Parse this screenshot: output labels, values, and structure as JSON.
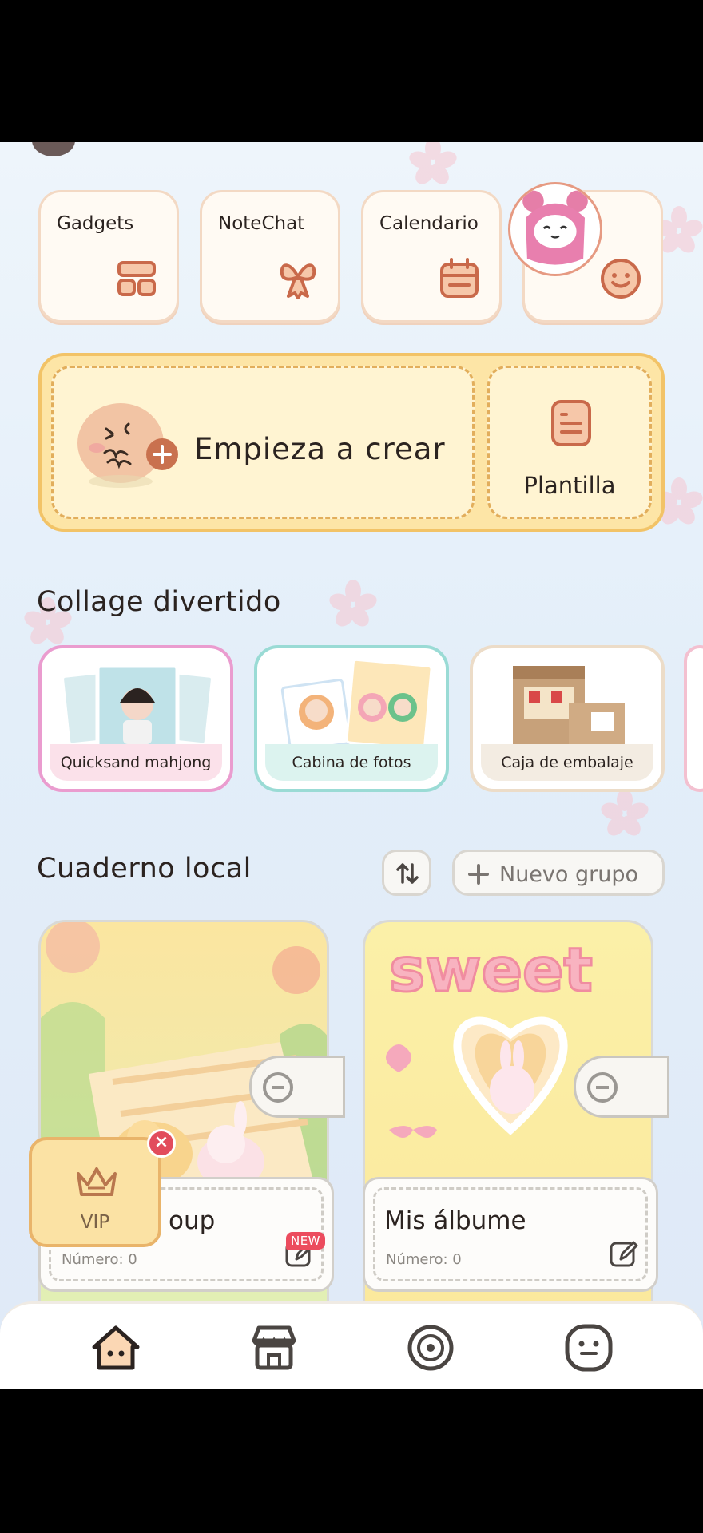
{
  "tiles": [
    {
      "label": "Gadgets",
      "icon": "widgets-icon"
    },
    {
      "label": "NoteChat",
      "icon": "bow-icon"
    },
    {
      "label": "Calendario",
      "icon": "calendar-icon"
    },
    {
      "label": "",
      "icon": "smiley-icon"
    }
  ],
  "create": {
    "title": "Empieza a crear",
    "template_label": "Plantilla"
  },
  "collage": {
    "title": "Collage divertido",
    "items": [
      {
        "label": "Quicksand mahjong"
      },
      {
        "label": "Cabina de fotos"
      },
      {
        "label": "Caja de embalaje"
      }
    ]
  },
  "local": {
    "title": "Cuaderno local",
    "new_group": "Nuevo grupo",
    "notebooks": [
      {
        "name": "oup",
        "count": "Número: 0",
        "badge": "NEW"
      },
      {
        "name": "Mis álbume",
        "count": "Número: 0"
      }
    ]
  },
  "vip": {
    "label": "VIP"
  },
  "nav": [
    "home-icon",
    "store-icon",
    "discover-icon",
    "profile-icon"
  ],
  "colors": {
    "accent_yellow": "#fde5a6",
    "border_yellow": "#f2c367",
    "pink": "#ec4c5e",
    "background": "#e3eef9"
  }
}
